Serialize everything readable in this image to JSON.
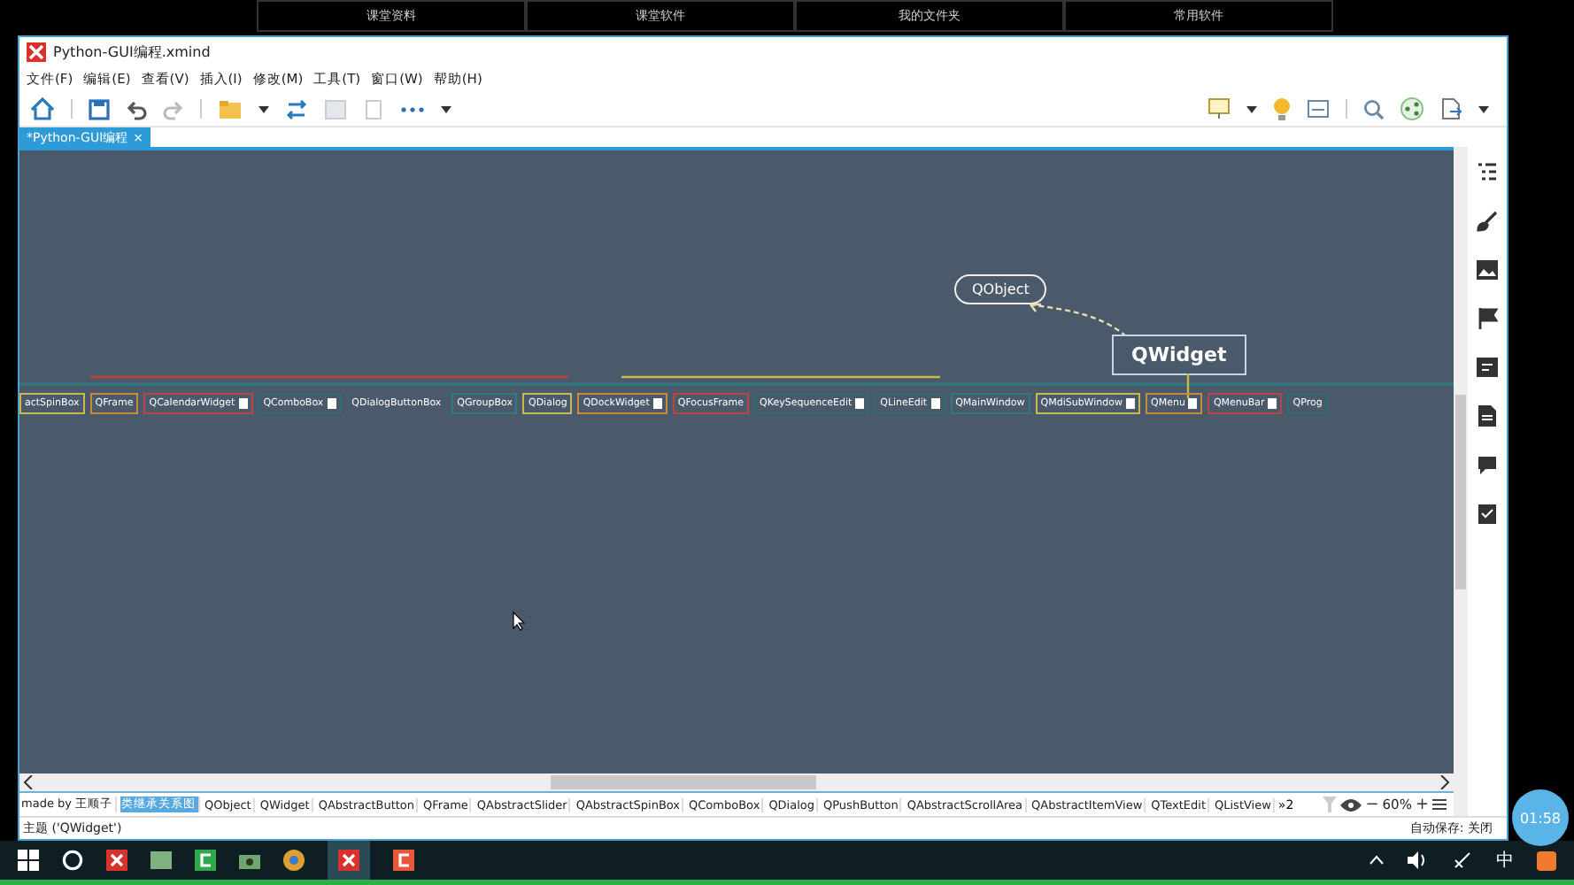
{
  "top_bar": {
    "items": [
      "课堂资料",
      "课堂软件",
      "我的文件夹",
      "常用软件"
    ]
  },
  "window": {
    "title": "Python-GUI编程.xmind"
  },
  "menu": [
    "文件(F)",
    "编辑(E)",
    "查看(V)",
    "插入(I)",
    "修改(M)",
    "工具(T)",
    "窗口(W)",
    "帮助(H)"
  ],
  "doc_tab": {
    "label": "*Python-GUI编程",
    "close": "×"
  },
  "map": {
    "parent": "QObject",
    "central": "QWidget",
    "nodes": [
      {
        "label": "actSpinBox",
        "color": "#c9b84c",
        "note": false
      },
      {
        "label": "QFrame",
        "color": "#c98a3e",
        "note": false
      },
      {
        "label": "QCalendarWidget",
        "color": "#b8463f",
        "note": true
      },
      {
        "label": "QComboBox",
        "color": "#2f6f73",
        "note": true
      },
      {
        "label": "QDialogButtonBox",
        "color": "#4a5a6b",
        "note": false
      },
      {
        "label": "QGroupBox",
        "color": "#2f7a80",
        "note": false
      },
      {
        "label": "QDialog",
        "color": "#c9b84c",
        "note": false
      },
      {
        "label": "QDockWidget",
        "color": "#c98a3e",
        "note": true
      },
      {
        "label": "QFocusFrame",
        "color": "#b8463f",
        "note": false
      },
      {
        "label": "QKeySequenceEdit",
        "color": "#2f6f73",
        "note": true
      },
      {
        "label": "QLineEdit",
        "color": "#2f6f73",
        "note": true
      },
      {
        "label": "QMainWindow",
        "color": "#2f7a80",
        "note": false
      },
      {
        "label": "QMdiSubWindow",
        "color": "#c9b84c",
        "note": true
      },
      {
        "label": "QMenu",
        "color": "#c98a3e",
        "note": true
      },
      {
        "label": "QMenuBar",
        "color": "#b8463f",
        "note": true
      },
      {
        "label": "QProg",
        "color": "#2f6f73",
        "note": false
      }
    ]
  },
  "sheet_tabs": [
    {
      "label": "made by 王顺子",
      "selected": false
    },
    {
      "label": "类继承关系图",
      "selected": true
    },
    {
      "label": "QObject",
      "selected": false
    },
    {
      "label": "QWidget",
      "selected": false
    },
    {
      "label": "QAbstractButton",
      "selected": false
    },
    {
      "label": "QFrame",
      "selected": false
    },
    {
      "label": "QAbstractSlider",
      "selected": false
    },
    {
      "label": "QAbstractSpinBox",
      "selected": false
    },
    {
      "label": "QComboBox",
      "selected": false
    },
    {
      "label": "QDialog",
      "selected": false
    },
    {
      "label": "QPushButton",
      "selected": false
    },
    {
      "label": "QAbstractScrollArea",
      "selected": false
    },
    {
      "label": "QAbstractItemView",
      "selected": false
    },
    {
      "label": "QTextEdit",
      "selected": false
    },
    {
      "label": "QListView",
      "selected": false
    }
  ],
  "more_tabs": "»2",
  "zoom": {
    "value": "60%",
    "minus": "−",
    "plus": "+"
  },
  "status_bar": {
    "topic": "主题 ('QWidget')",
    "autosave": "自动保存: 关闭"
  },
  "timer": "01:58",
  "taskbar": {
    "ime": "中"
  }
}
